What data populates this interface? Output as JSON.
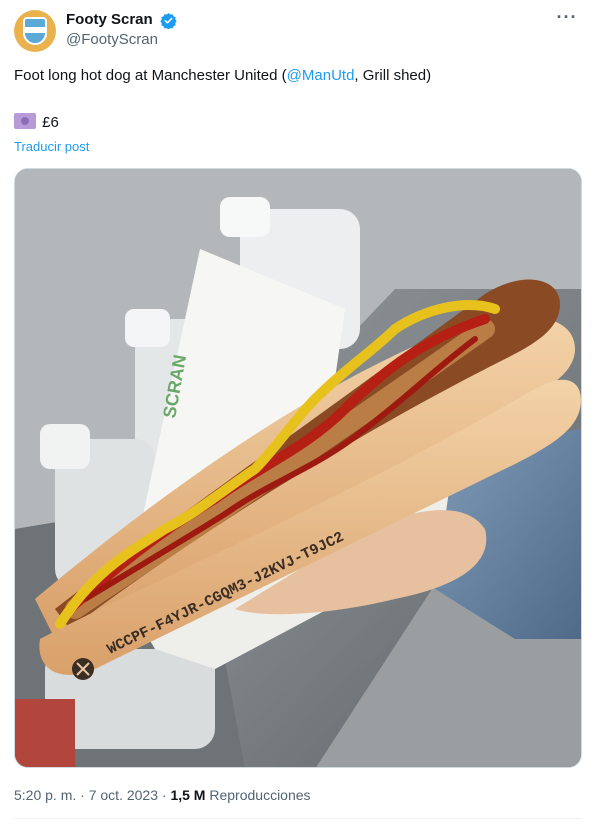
{
  "author": {
    "display_name": "Footy Scran",
    "handle": "@FootyScran",
    "verified": true
  },
  "post": {
    "text_before": "Foot long hot dog at Manchester United (",
    "mention": "@ManUtd",
    "text_after": ", Grill shed)",
    "price": "£6",
    "price_icon": "money-banknote-emoji",
    "translate_label": "Traducir post"
  },
  "media": {
    "bun_print": "WCCPF-F4YJR-CGQM3-J2KVJ-T9JC2"
  },
  "meta": {
    "time": "5:20 p. m.",
    "date": "7 oct. 2023",
    "separator": "·",
    "views_count": "1,5 M",
    "views_label": "Reproducciones"
  },
  "colors": {
    "link": "#1d9bf0",
    "verified": "#1d9bf0",
    "secondary_text": "#536471"
  }
}
